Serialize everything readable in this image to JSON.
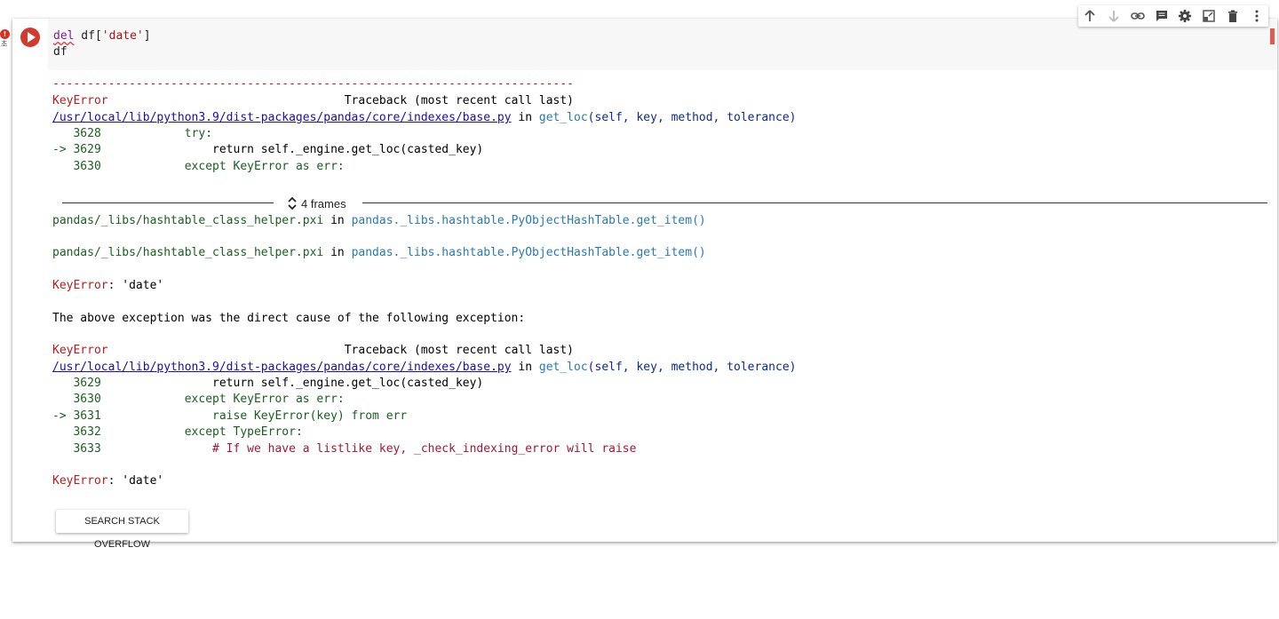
{
  "cell": {
    "error_badge": "!",
    "exec_count": "초",
    "code_lines": {
      "del_kw": "del",
      "line1_rest": " df[",
      "line1_str": "'date'",
      "line1_end": "]",
      "line2": "df"
    }
  },
  "toolbar": {
    "items": [
      {
        "name": "move-up",
        "icon": "arrow-up-icon"
      },
      {
        "name": "move-down",
        "icon": "arrow-down-icon"
      },
      {
        "name": "link",
        "icon": "link-icon"
      },
      {
        "name": "comment",
        "icon": "comment-icon"
      },
      {
        "name": "settings",
        "icon": "gear-icon"
      },
      {
        "name": "mirror",
        "icon": "mirror-icon"
      },
      {
        "name": "delete",
        "icon": "trash-icon"
      },
      {
        "name": "more",
        "icon": "more-vert-icon"
      }
    ]
  },
  "output": {
    "divider": "---------------------------------------------------------------------------",
    "tb1": {
      "err": "KeyError",
      "header": "                                  Traceback (most recent call last)",
      "file": "/usr/local/lib/python3.9/dist-packages/pandas/core/indexes/base.py",
      "in": " in ",
      "func": "get_loc",
      "args": "(self, key, method, tolerance)",
      "lines": [
        {
          "arrow": "   ",
          "num": "3628",
          "code": "            try:"
        },
        {
          "arrow": "-> ",
          "num": "3629",
          "code": "                return self._engine.get_loc(casted_key)"
        },
        {
          "arrow": "   ",
          "num": "3630",
          "code": "            except KeyError as err:"
        }
      ]
    },
    "frames_label": "4 frames",
    "pxi1": {
      "file": "pandas/_libs/hashtable_class_helper.pxi",
      "in": " in ",
      "func": "pandas._libs.hashtable.PyObjectHashTable.get_item()"
    },
    "pxi2": {
      "file": "pandas/_libs/hashtable_class_helper.pxi",
      "in": " in ",
      "func": "pandas._libs.hashtable.PyObjectHashTable.get_item()"
    },
    "keyerror1": {
      "err": "KeyError",
      "msg": ": 'date'"
    },
    "cause": "The above exception was the direct cause of the following exception:",
    "tb2": {
      "err": "KeyError",
      "header": "                                  Traceback (most recent call last)",
      "file": "/usr/local/lib/python3.9/dist-packages/pandas/core/indexes/base.py",
      "in": " in ",
      "func": "get_loc",
      "args": "(self, key, method, tolerance)",
      "lines": [
        {
          "arrow": "   ",
          "num": "3629",
          "code": "                return self._engine.get_loc(casted_key)"
        },
        {
          "arrow": "   ",
          "num": "3630",
          "code": "            except KeyError as err:"
        },
        {
          "arrow": "-> ",
          "num": "3631",
          "code": "                raise KeyError(key) from err"
        },
        {
          "arrow": "   ",
          "num": "3632",
          "code": "            except TypeError:"
        },
        {
          "arrow": "   ",
          "num": "3633",
          "code": "                # If we have a listlike key, _check_indexing_error will raise"
        }
      ]
    },
    "keyerror2": {
      "err": "KeyError",
      "msg": ": 'date'"
    }
  },
  "search_button": "SEARCH STACK OVERFLOW"
}
